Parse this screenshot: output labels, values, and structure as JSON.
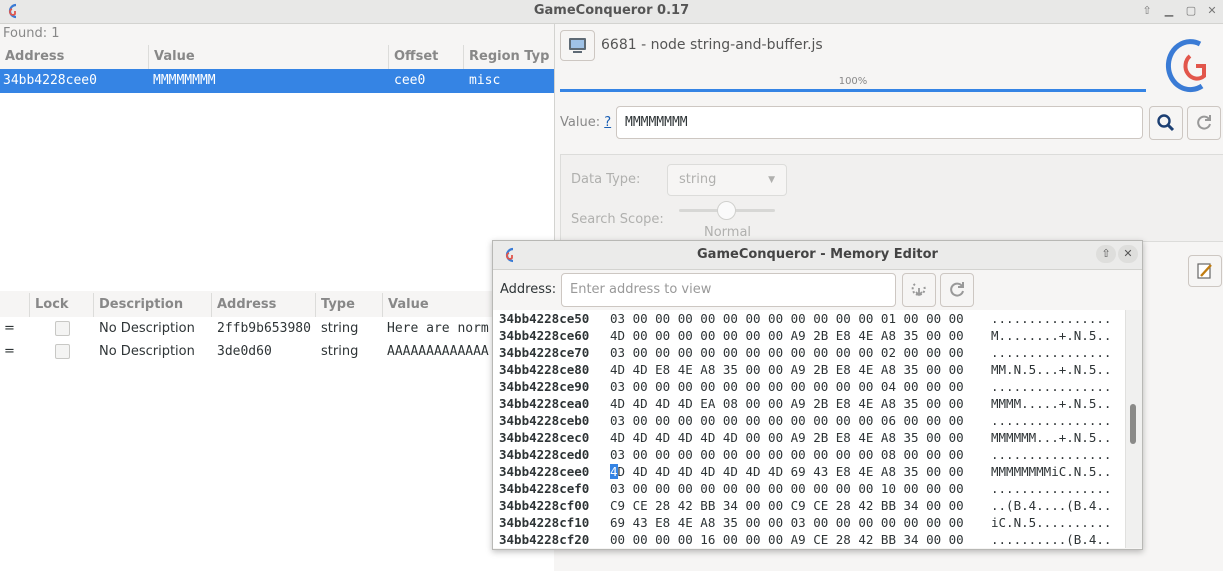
{
  "window": {
    "title": "GameConqueror 0.17"
  },
  "results": {
    "found_label": "Found: 1",
    "columns": [
      "Address",
      "Value",
      "Offset",
      "Region Typ"
    ],
    "rows": [
      {
        "address": "34bb4228cee0",
        "value": "MMMMMMMM",
        "offset": "cee0",
        "region": "misc"
      }
    ]
  },
  "process": {
    "label": "6681 - node string-and-buffer.js"
  },
  "progress": {
    "text": "100%",
    "fraction": 1.0
  },
  "search": {
    "value_label": "Value:",
    "help_link": "?",
    "value": "MMMMMMMM"
  },
  "options": {
    "data_type_label": "Data Type:",
    "data_type_value": "string",
    "scope_label": "Search Scope:",
    "scope_value": "Normal"
  },
  "cheats": {
    "columns": [
      "Lock",
      "Description",
      "Address",
      "Type",
      "Value"
    ],
    "rows": [
      {
        "marker": "=",
        "description": "No Description",
        "address": "2ffb9b653980",
        "type": "string",
        "value": "Here are norm"
      },
      {
        "marker": "=",
        "description": "No Description",
        "address": "3de0d60",
        "type": "string",
        "value": "AAAAAAAAAAAAA"
      }
    ]
  },
  "memory_editor": {
    "title": "GameConqueror - Memory Editor",
    "address_label": "Address:",
    "address_placeholder": "Enter address to view",
    "rows": [
      {
        "addr": "34bb4228ce50",
        "bytes": "03 00 00 00 00 00 00 00 00 00 00 00 01 00 00 00",
        "ascii": "................"
      },
      {
        "addr": "34bb4228ce60",
        "bytes": "4D 00 00 00 00 00 00 00 A9 2B E8 4E A8 35 00 00",
        "ascii": "M........+.N.5.."
      },
      {
        "addr": "34bb4228ce70",
        "bytes": "03 00 00 00 00 00 00 00 00 00 00 00 02 00 00 00",
        "ascii": "................"
      },
      {
        "addr": "34bb4228ce80",
        "bytes": "4D 4D E8 4E A8 35 00 00 A9 2B E8 4E A8 35 00 00",
        "ascii": "MM.N.5...+.N.5.."
      },
      {
        "addr": "34bb4228ce90",
        "bytes": "03 00 00 00 00 00 00 00 00 00 00 00 04 00 00 00",
        "ascii": "................"
      },
      {
        "addr": "34bb4228cea0",
        "bytes": "4D 4D 4D 4D EA 08 00 00 A9 2B E8 4E A8 35 00 00",
        "ascii": "MMMM.....+.N.5.."
      },
      {
        "addr": "34bb4228ceb0",
        "bytes": "03 00 00 00 00 00 00 00 00 00 00 00 06 00 00 00",
        "ascii": "................"
      },
      {
        "addr": "34bb4228cec0",
        "bytes": "4D 4D 4D 4D 4D 4D 00 00 A9 2B E8 4E A8 35 00 00",
        "ascii": "MMMMMM...+.N.5.."
      },
      {
        "addr": "34bb4228ced0",
        "bytes": "03 00 00 00 00 00 00 00 00 00 00 00 08 00 00 00",
        "ascii": "................"
      },
      {
        "addr": "34bb4228cee0",
        "bytes_cursor": "4",
        "bytes": "D 4D 4D 4D 4D 4D 4D 4D 69 43 E8 4E A8 35 00 00",
        "ascii": "MMMMMMMMiC.N.5.."
      },
      {
        "addr": "34bb4228cef0",
        "bytes": "03 00 00 00 00 00 00 00 00 00 00 00 10 00 00 00",
        "ascii": "................"
      },
      {
        "addr": "34bb4228cf00",
        "bytes": "C9 CE 28 42 BB 34 00 00 C9 CE 28 42 BB 34 00 00",
        "ascii": "..(B.4....(B.4.."
      },
      {
        "addr": "34bb4228cf10",
        "bytes": "69 43 E8 4E A8 35 00 00 03 00 00 00 00 00 00 00",
        "ascii": "iC.N.5.........."
      },
      {
        "addr": "34bb4228cf20",
        "bytes": "00 00 00 00 16 00 00 00 A9 CE 28 42 BB 34 00 00",
        "ascii": "..........(B.4.."
      }
    ]
  },
  "colors": {
    "accent": "#3584e4",
    "logo_blue": "#3a7bd5",
    "logo_red": "#e2564b"
  },
  "icons": [
    "app-logo-icon",
    "computer-icon",
    "search-icon",
    "reset-icon",
    "edit-icon",
    "pin-icon",
    "close-icon",
    "minimize-icon",
    "maximize-icon"
  ]
}
